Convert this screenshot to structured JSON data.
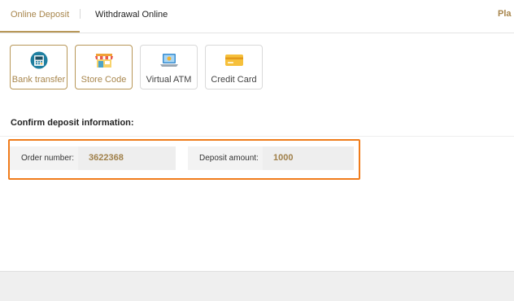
{
  "tabs": [
    {
      "label": "Online Deposit",
      "active": true
    },
    {
      "label": "Withdrawal Online",
      "active": false
    }
  ],
  "tab_right_partial": "Pla",
  "methods": [
    {
      "label": "Bank transfer",
      "icon": "bank-atm-icon",
      "active": true
    },
    {
      "label": "Store Code",
      "icon": "store-icon",
      "active": true
    },
    {
      "label": "Virtual ATM",
      "icon": "laptop-icon",
      "active": false
    },
    {
      "label": "Credit Card",
      "icon": "credit-card-icon",
      "active": false
    }
  ],
  "section_title": "Confirm deposit information:",
  "order": {
    "label": "Order number:",
    "value": "3622368"
  },
  "deposit": {
    "label": "Deposit amount:",
    "value": "1000"
  },
  "colors": {
    "accent": "#a8864d",
    "highlight_border": "#f07c1b"
  }
}
